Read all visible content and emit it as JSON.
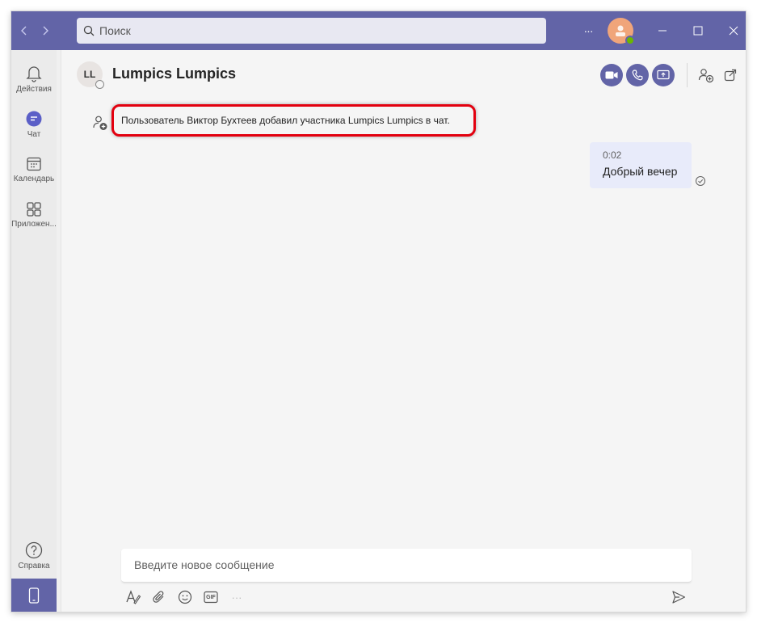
{
  "titlebar": {
    "search_placeholder": "Поиск",
    "more_label": "···"
  },
  "rail": {
    "items": [
      {
        "label": "Действия",
        "icon": "bell-icon"
      },
      {
        "label": "Чат",
        "icon": "chat-icon"
      },
      {
        "label": "Календарь",
        "icon": "calendar-icon"
      },
      {
        "label": "Приложен...",
        "icon": "apps-icon"
      }
    ],
    "help_label": "Справка"
  },
  "chat": {
    "avatar_initials": "LL",
    "title": "Lumpics Lumpics"
  },
  "messages": {
    "system_text": "Пользователь Виктор Бухтеев добавил участника Lumpics Lumpics в чат.",
    "outgoing_time": "0:02",
    "outgoing_text": "Добрый вечер"
  },
  "compose": {
    "placeholder": "Введите новое сообщение",
    "gif_label": "GIF",
    "more_label": "···"
  },
  "colors": {
    "accent": "#6264a7",
    "highlight": "#e3000f",
    "bubble": "#e8ebfa"
  }
}
